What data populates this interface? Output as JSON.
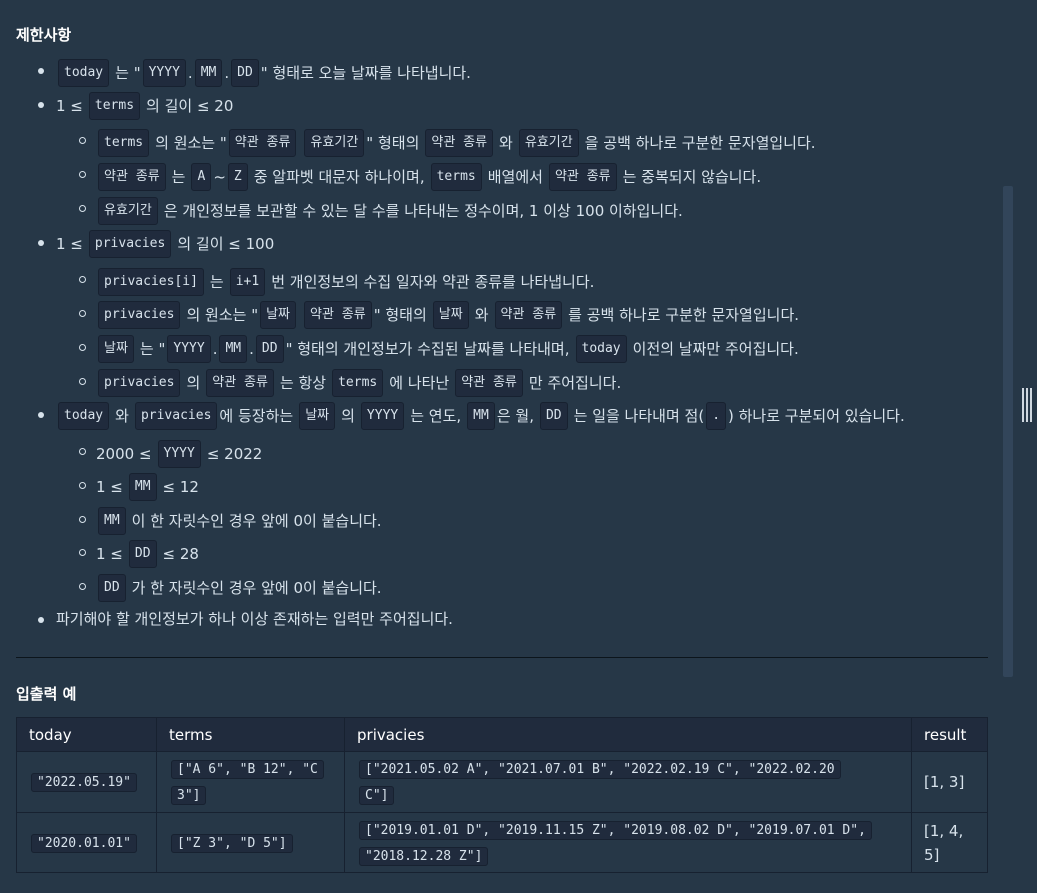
{
  "heading_constraints": "제한사항",
  "heading_examples": "입출력 예",
  "c": {
    "today": "today",
    "YYYY": "YYYY",
    "MM": "MM",
    "DD": "DD",
    "dot": ".",
    "terms": "terms",
    "privacies": "privacies",
    "privacies_i": "privacies[i]",
    "i1": "i+1",
    "term_kind": "약관 종류",
    "valid_period": "유효기간",
    "date": "날짜",
    "A": "A",
    "Z": "Z"
  },
  "t": {
    "l1_a": "는 \"",
    "quote_end": "\"",
    "l1_b": "\" 형태로 오늘 날짜를 나타냅니다.",
    "le1": "1 ≤",
    "len_le_20": "의 길이 ≤ 20",
    "l3_a": "의 원소는 \"",
    "l3_b": "\" 형태의",
    "and": "와",
    "l3_c": "을 공백 하나로 구분한 문자열입니다.",
    "is": "는",
    "tilde": "~",
    "l4_a": "중 알파벳 대문자 하나이며,",
    "l4_b": "배열에서",
    "l4_c": "는 중복되지 않습니다.",
    "l5": "은 개인정보를 보관할 수 있는 달 수를 나타내는 정수이며, 1 이상 100 이하입니다.",
    "len_le_100": "의 길이 ≤ 100",
    "l7": "번 개인정보의 수집 일자와 약관 종류를 나타냅니다.",
    "l8_c": "를 공백 하나로 구분한 문자열입니다.",
    "is_quote": "는 \"",
    "l9_b": "\" 형태의 개인정보가 수집된 날짜를 나타내며,",
    "l9_c": "이전의 날짜만 주어집니다.",
    "of": "의",
    "l10_a": "는 항상",
    "l10_b": "에 나타난",
    "l10_c": "만 주어집니다.",
    "l11_a": "에 등장하는",
    "l11_b": "는 연도,",
    "l11_c": "은 월,",
    "l11_d": "는 일을 나타내며 점(",
    "l11_e": ") 하나로 구분되어 있습니다.",
    "y_pre": "2000 ≤",
    "y_post": "≤ 2022",
    "m_post": "≤ 12",
    "mm_pad": "이 한 자릿수인 경우 앞에 0이 붙습니다.",
    "d_post": "≤ 28",
    "dd_pad": "가 한 자릿수인 경우 앞에 0이 붙습니다.",
    "last": "파기해야 할 개인정보가 하나 이상 존재하는 입력만 주어집니다."
  },
  "table": {
    "headers": [
      "today",
      "terms",
      "privacies",
      "result"
    ],
    "rows": [
      {
        "today": "\"2022.05.19\"",
        "terms_1": "[\"A 6\", \"B 12\", \"C",
        "terms_2": "3\"]",
        "priv_1": "[\"2021.05.02 A\", \"2021.07.01 B\", \"2022.02.19 C\", \"2022.02.20",
        "priv_2": "C\"]",
        "result_1": "[1, 3]",
        "result_2": ""
      },
      {
        "today": "\"2020.01.01\"",
        "terms_1": "[\"Z 3\", \"D 5\"]",
        "terms_2": "",
        "priv_1": "[\"2019.01.01 D\", \"2019.11.15 Z\", \"2019.08.02 D\", \"2019.07.01 D\",",
        "priv_2": "\"2018.12.28 Z\"]",
        "result_1": "[1, 4,",
        "result_2": "5]"
      }
    ]
  }
}
